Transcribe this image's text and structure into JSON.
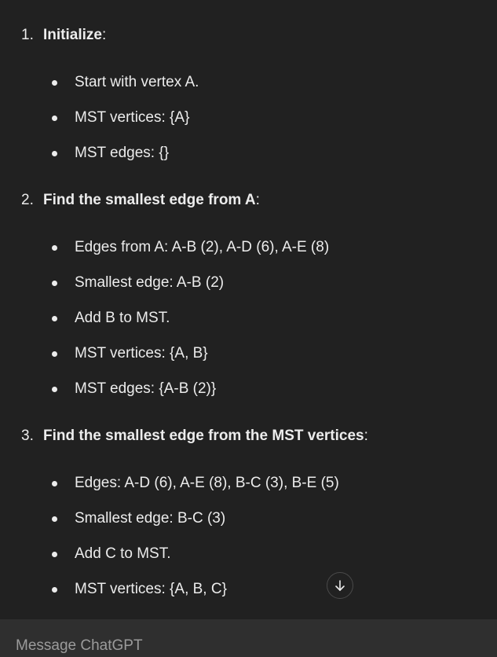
{
  "steps": [
    {
      "num": "1.",
      "title": "Initialize",
      "suffix": ":",
      "bullets": [
        "Start with vertex A.",
        "MST vertices: {A}",
        "MST edges: {}"
      ]
    },
    {
      "num": "2.",
      "title": "Find the smallest edge from A",
      "suffix": ":",
      "bullets": [
        "Edges from A: A-B (2), A-D (6), A-E (8)",
        "Smallest edge: A-B (2)",
        "Add B to MST.",
        "MST vertices: {A, B}",
        "MST edges: {A-B (2)}"
      ]
    },
    {
      "num": "3.",
      "title": "Find the smallest edge from the MST vertices",
      "suffix": ":",
      "bullets": [
        "Edges: A-D (6), A-E (8), B-C (3), B-E (5)",
        "Smallest edge: B-C (3)",
        "Add C to MST.",
        "MST vertices: {A, B, C}"
      ]
    }
  ],
  "scroll_button": {
    "icon": "arrow-down-icon"
  },
  "composer": {
    "placeholder": "Message ChatGPT"
  }
}
